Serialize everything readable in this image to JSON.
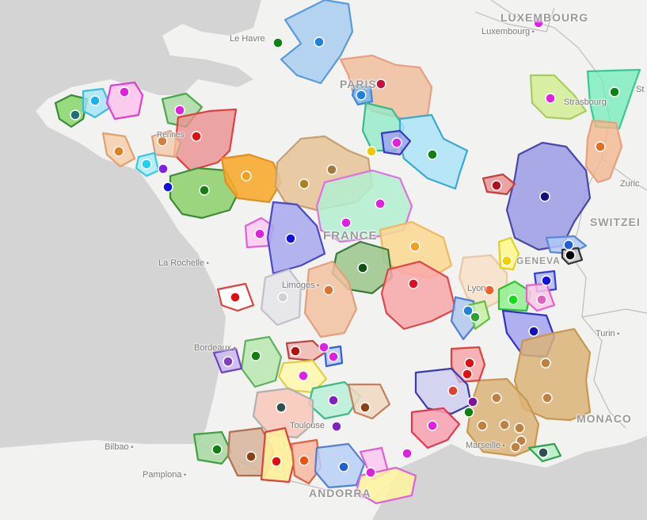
{
  "map": {
    "labels": {
      "luxembourg_country": "LUXEMBOURG",
      "luxembourg_city": "Luxembourg",
      "le_havre": "Le Havre",
      "paris": "PARIS",
      "strasbourg": "Strasbourg",
      "zurich": "Zuric",
      "switzerland": "SWITZEI",
      "france": "FRANCE",
      "la_rochelle": "La Rochelle",
      "limoges": "Limoges",
      "geneva": "GENEVA",
      "lyon": "Lyon",
      "turin": "Turin",
      "bordeaux": "Bordeaux",
      "toulouse": "Toulouse",
      "marseille": "Marseille",
      "monaco": "MONACO",
      "bilbao": "Bilbao",
      "pamplona": "Pamplona",
      "andorra": "ANDORRA",
      "st_edge": "St",
      "rennes": "Rennes"
    },
    "colors": {
      "land": "#f2f2f0",
      "sea": "#d4d4d4",
      "border": "#bdbdbd"
    }
  }
}
